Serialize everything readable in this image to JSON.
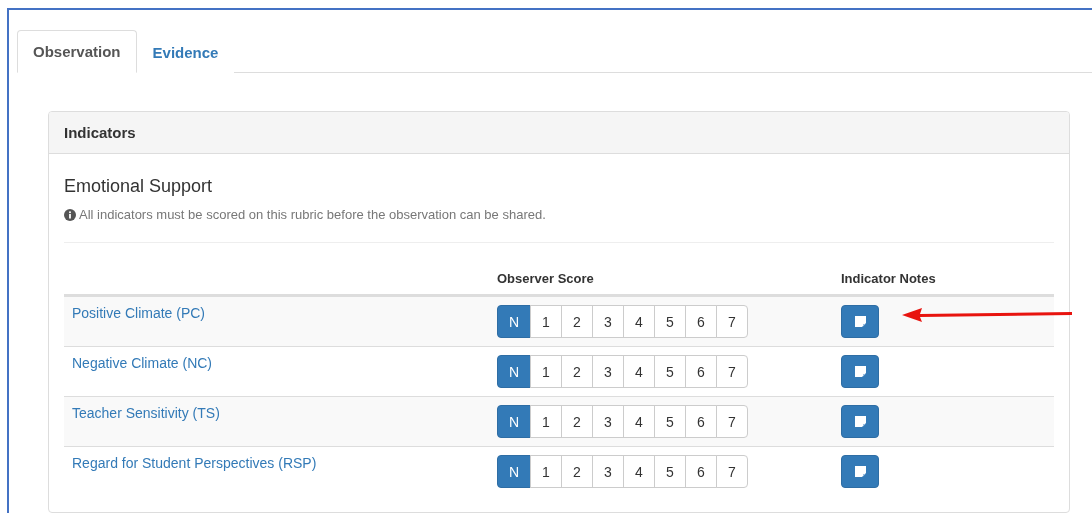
{
  "tabs": [
    {
      "label": "Observation",
      "selected": true
    },
    {
      "label": "Evidence",
      "selected": false
    }
  ],
  "panel": {
    "title": "Indicators",
    "section": "Emotional Support",
    "note": "All indicators must be scored on this rubric before the observation can be shared."
  },
  "table": {
    "columns": [
      "",
      "Observer Score",
      "Indicator Notes"
    ],
    "rows": [
      {
        "name": "Positive Climate (PC)",
        "scores": [
          {
            "label": "N",
            "selected": true
          },
          {
            "label": "1",
            "selected": false
          },
          {
            "label": "2",
            "selected": false
          },
          {
            "label": "3",
            "selected": false
          },
          {
            "label": "4",
            "selected": false
          },
          {
            "label": "5",
            "selected": false
          },
          {
            "label": "6",
            "selected": false
          },
          {
            "label": "7",
            "selected": false
          }
        ]
      },
      {
        "name": "Negative Climate (NC)",
        "scores": [
          {
            "label": "N",
            "selected": true
          },
          {
            "label": "1",
            "selected": false
          },
          {
            "label": "2",
            "selected": false
          },
          {
            "label": "3",
            "selected": false
          },
          {
            "label": "4",
            "selected": false
          },
          {
            "label": "5",
            "selected": false
          },
          {
            "label": "6",
            "selected": false
          },
          {
            "label": "7",
            "selected": false
          }
        ]
      },
      {
        "name": "Teacher Sensitivity (TS)",
        "scores": [
          {
            "label": "N",
            "selected": true
          },
          {
            "label": "1",
            "selected": false
          },
          {
            "label": "2",
            "selected": false
          },
          {
            "label": "3",
            "selected": false
          },
          {
            "label": "4",
            "selected": false
          },
          {
            "label": "5",
            "selected": false
          },
          {
            "label": "6",
            "selected": false
          },
          {
            "label": "7",
            "selected": false
          }
        ]
      },
      {
        "name": "Regard for Student Perspectives (RSP)",
        "scores": [
          {
            "label": "N",
            "selected": true
          },
          {
            "label": "1",
            "selected": false
          },
          {
            "label": "2",
            "selected": false
          },
          {
            "label": "3",
            "selected": false
          },
          {
            "label": "4",
            "selected": false
          },
          {
            "label": "5",
            "selected": false
          },
          {
            "label": "6",
            "selected": false
          },
          {
            "label": "7",
            "selected": false
          }
        ]
      }
    ]
  }
}
